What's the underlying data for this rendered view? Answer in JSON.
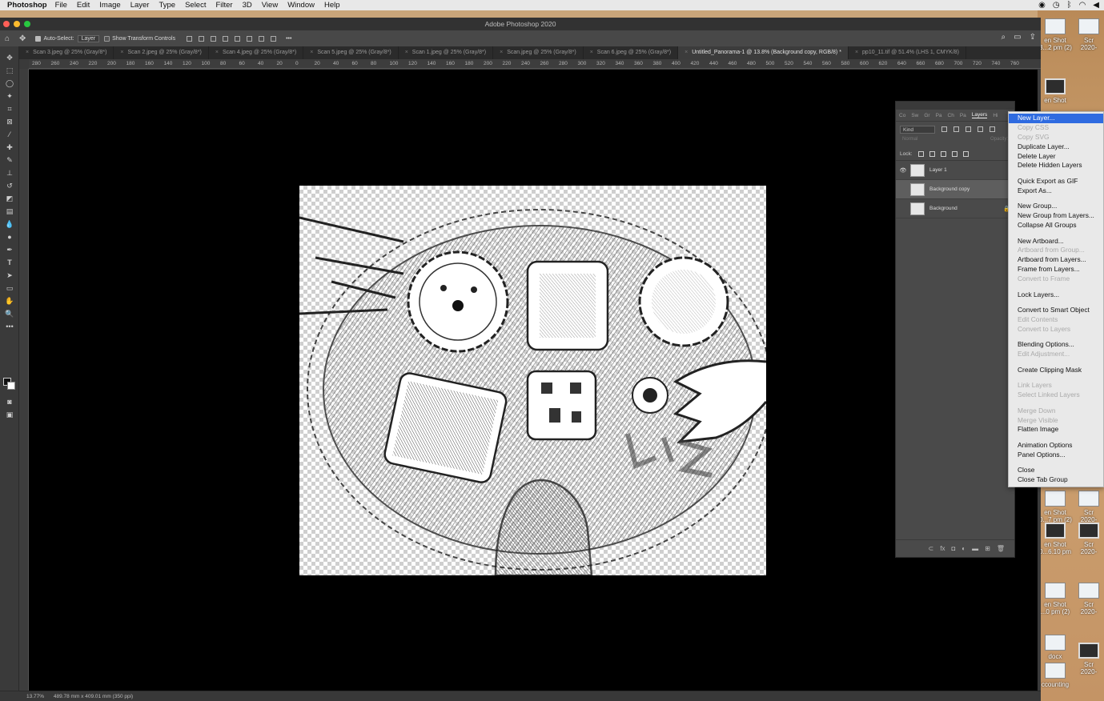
{
  "menubar": {
    "app": "Photoshop",
    "items": [
      "File",
      "Edit",
      "Image",
      "Layer",
      "Type",
      "Select",
      "Filter",
      "3D",
      "View",
      "Window",
      "Help"
    ],
    "status_icons": [
      "camera-icon",
      "clock-icon",
      "bluetooth-icon",
      "wifi-icon",
      "volume-icon"
    ]
  },
  "window": {
    "title": "Adobe Photoshop 2020",
    "traffic_colors": [
      "#fe5f57",
      "#febc2e",
      "#28c840"
    ]
  },
  "options": {
    "auto_select": "Auto-Select:",
    "layer_select": "Layer",
    "transform": "Show Transform Controls",
    "more": "•••"
  },
  "tabs": [
    "Scan 3.jpeg @ 25% (Gray/8*)",
    "Scan 2.jpeg @ 25% (Gray/8*)",
    "Scan 4.jpeg @ 25% (Gray/8*)",
    "Scan 5.jpeg @ 25% (Gray/8*)",
    "Scan 1.jpeg @ 25% (Gray/8*)",
    "Scan.jpeg @ 25% (Gray/8*)",
    "Scan 6.jpeg @ 25% (Gray/8*)",
    "Untitled_Panorama-1 @ 13.8% (Background copy, RGB/8) *",
    "pp10_11.tif @ 51.4% (LHS 1, CMYK/8)"
  ],
  "active_tab": 7,
  "ruler_labels": [
    "280",
    "260",
    "240",
    "220",
    "200",
    "180",
    "160",
    "140",
    "120",
    "100",
    "80",
    "60",
    "40",
    "20",
    "0",
    "20",
    "40",
    "60",
    "80",
    "100",
    "120",
    "140",
    "160",
    "180",
    "200",
    "220",
    "240",
    "260",
    "280",
    "300",
    "320",
    "340",
    "360",
    "380",
    "400",
    "420",
    "440",
    "460",
    "480",
    "500",
    "520",
    "540",
    "560",
    "580",
    "600",
    "620",
    "640",
    "660",
    "680",
    "700",
    "720",
    "740",
    "760"
  ],
  "status": {
    "zoom": "13.77%",
    "doc": "489.78 mm x 409.01 mm (350 ppi)"
  },
  "layers_panel": {
    "tabs": [
      "Co",
      "Sw",
      "Gr",
      "Pa",
      "Ch",
      "Pa",
      "Layers",
      "Hi"
    ],
    "filter_kind": "Kind",
    "lock_label": "Lock:",
    "mode": "Normal",
    "opacity": "Opacity:",
    "layers": [
      {
        "name": "Layer 1",
        "visible": true,
        "selected": false,
        "locked": false
      },
      {
        "name": "Background copy",
        "visible": false,
        "selected": true,
        "locked": false
      },
      {
        "name": "Background",
        "visible": false,
        "selected": false,
        "locked": true
      }
    ],
    "footer_icons": [
      "link-icon",
      "fx-icon",
      "mask-icon",
      "adjustment-icon",
      "folder-icon",
      "new-layer-icon",
      "trash-icon"
    ]
  },
  "context_menu": {
    "groups": [
      [
        {
          "label": "New Layer...",
          "enabled": true,
          "highlighted": true
        },
        {
          "label": "Copy CSS",
          "enabled": false
        },
        {
          "label": "Copy SVG",
          "enabled": false
        },
        {
          "label": "Duplicate Layer...",
          "enabled": true
        },
        {
          "label": "Delete Layer",
          "enabled": true
        },
        {
          "label": "Delete Hidden Layers",
          "enabled": true
        }
      ],
      [
        {
          "label": "Quick Export as GIF",
          "enabled": true
        },
        {
          "label": "Export As...",
          "enabled": true
        }
      ],
      [
        {
          "label": "New Group...",
          "enabled": true
        },
        {
          "label": "New Group from Layers...",
          "enabled": true
        },
        {
          "label": "Collapse All Groups",
          "enabled": true
        }
      ],
      [
        {
          "label": "New Artboard...",
          "enabled": true
        },
        {
          "label": "Artboard from Group...",
          "enabled": false
        },
        {
          "label": "Artboard from Layers...",
          "enabled": true
        },
        {
          "label": "Frame from Layers...",
          "enabled": true
        },
        {
          "label": "Convert to Frame",
          "enabled": false
        }
      ],
      [
        {
          "label": "Lock Layers...",
          "enabled": true
        }
      ],
      [
        {
          "label": "Convert to Smart Object",
          "enabled": true
        },
        {
          "label": "Edit Contents",
          "enabled": false
        },
        {
          "label": "Convert to Layers",
          "enabled": false
        }
      ],
      [
        {
          "label": "Blending Options...",
          "enabled": true
        },
        {
          "label": "Edit Adjustment...",
          "enabled": false
        }
      ],
      [
        {
          "label": "Create Clipping Mask",
          "enabled": true
        }
      ],
      [
        {
          "label": "Link Layers",
          "enabled": false
        },
        {
          "label": "Select Linked Layers",
          "enabled": false
        }
      ],
      [
        {
          "label": "Merge Down",
          "enabled": false
        },
        {
          "label": "Merge Visible",
          "enabled": false
        },
        {
          "label": "Flatten Image",
          "enabled": true
        }
      ],
      [
        {
          "label": "Animation Options",
          "enabled": true
        },
        {
          "label": "Panel Options...",
          "enabled": true
        }
      ],
      [
        {
          "label": "Close",
          "enabled": true
        },
        {
          "label": "Close Tab Group",
          "enabled": true
        }
      ]
    ]
  },
  "desktop": {
    "items": [
      {
        "label": "en Shot\n3...2 pm (2)",
        "thumb": "light"
      },
      {
        "label": "Scr\n2020-",
        "thumb": "light"
      },
      {
        "label": "en Shot",
        "thumb": "dark"
      },
      {
        "label": "en Shot\n0...7 pm (2)",
        "thumb": "light"
      },
      {
        "label": "Scr\n2020-",
        "thumb": "light"
      },
      {
        "label": "en Shot\n0...6.10 pm",
        "thumb": "dark"
      },
      {
        "label": "Scr\n2020-",
        "thumb": "dark"
      },
      {
        "label": "en Shot\n...0 pm (2)",
        "thumb": "light"
      },
      {
        "label": "Scr\n2020-",
        "thumb": "light"
      },
      {
        "label": "docx",
        "thumb": "light"
      },
      {
        "label": "ccounting",
        "thumb": "light"
      },
      {
        "label": "Scr\n2020-",
        "thumb": "dark"
      }
    ]
  }
}
